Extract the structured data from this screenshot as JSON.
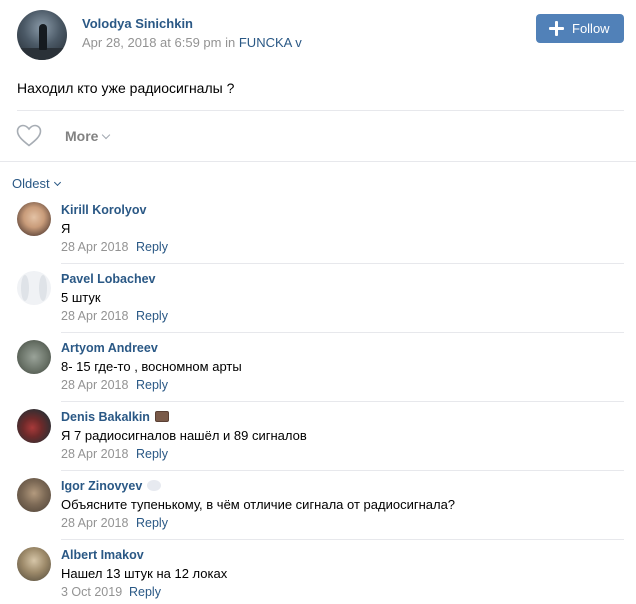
{
  "post": {
    "author": "Volodya Sinichkin",
    "date": "Apr 28, 2018 at 6:59 pm",
    "in_text": "in",
    "group": "FUNCKA",
    "group_suffix": " v",
    "text": "Находил кто уже радиосигналы ?",
    "follow_label": "Follow",
    "more_label": "More"
  },
  "comments_sort": "Oldest",
  "comments": [
    {
      "name": "Kirill Korolyov",
      "text": "Я",
      "date": "28 Apr 2018",
      "reply": "Reply",
      "badge": ""
    },
    {
      "name": "Pavel Lobachev",
      "text": "5 штук",
      "date": "28 Apr 2018",
      "reply": "Reply",
      "badge": ""
    },
    {
      "name": "Artyom Andreev",
      "text": "8- 15 где-то , восномном арты",
      "date": "28 Apr 2018",
      "reply": "Reply",
      "badge": ""
    },
    {
      "name": "Denis Bakalkin",
      "text": "Я 7 радиосигналов нашёл и 89 сигналов",
      "date": "28 Apr 2018",
      "reply": "Reply",
      "badge": "briefcase-icon"
    },
    {
      "name": "Igor Zinovyev",
      "text": "Объясните тупенькому, в чём отличие сигнала от радиосигнала?",
      "date": "28 Apr 2018",
      "reply": "Reply",
      "badge": "bird-icon"
    },
    {
      "name": "Albert Imakov",
      "text": "Нашел 13 штук на 12 локах",
      "date": "3 Oct 2019",
      "reply": "Reply",
      "badge": ""
    }
  ],
  "colors": {
    "link": "#2a5885",
    "button": "#5181b8",
    "meta": "#939393",
    "divider": "#e7e8ec"
  }
}
